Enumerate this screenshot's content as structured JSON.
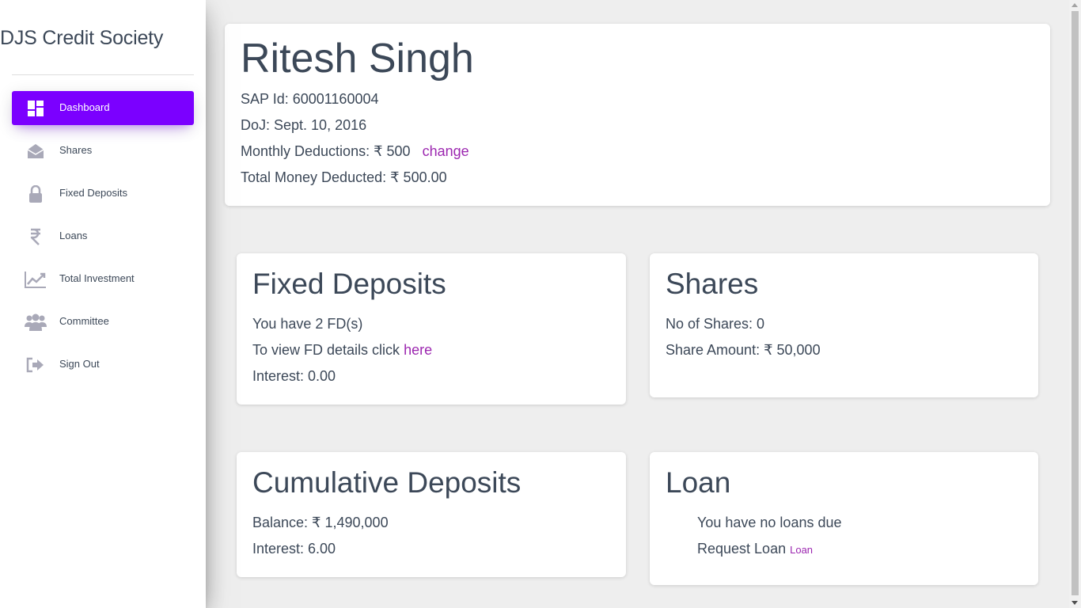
{
  "sidebar": {
    "brand": "DJS Credit Society",
    "items": [
      {
        "label": "Dashboard",
        "icon": "dashboard-icon",
        "active": true
      },
      {
        "label": "Shares",
        "icon": "envelope-open-icon"
      },
      {
        "label": "Fixed Deposits",
        "icon": "lock-icon"
      },
      {
        "label": "Loans",
        "icon": "rupee-icon"
      },
      {
        "label": "Total Investment",
        "icon": "trending-up-icon"
      },
      {
        "label": "Committee",
        "icon": "group-icon"
      },
      {
        "label": "Sign Out",
        "icon": "sign-out-icon"
      }
    ],
    "colors": {
      "active": "#7b00ff",
      "icon": "#a9a9b8"
    }
  },
  "profile": {
    "name": "Ritesh Singh",
    "sap_id": "SAP Id: 60001160004",
    "doj": "DoJ: Sept. 10, 2016",
    "monthly_deductions": "Monthly Deductions: ₹ 500",
    "change_link": "change",
    "total_deducted": "Total Money Deducted: ₹ 500.00"
  },
  "fixed_deposits": {
    "title": "Fixed Deposits",
    "count_text": "You have 2 FD(s)",
    "view_text": "To view FD details click",
    "view_link": "here",
    "interest": "Interest: 0.00"
  },
  "shares": {
    "title": "Shares",
    "count": "No of Shares: 0",
    "amount": "Share Amount: ₹ 50,000"
  },
  "cumulative": {
    "title": "Cumulative Deposits",
    "balance": "Balance: ₹ 1,490,000",
    "interest": "Interest: 6.00"
  },
  "loan": {
    "title": "Loan",
    "status": "You have no loans due",
    "request_text": "Request Loan",
    "request_link": "Loan"
  },
  "link_color": "#9c27b0"
}
